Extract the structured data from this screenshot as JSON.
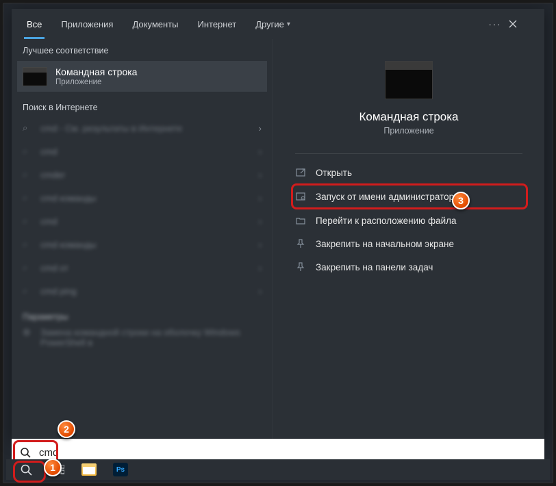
{
  "tabs": {
    "all": "Все",
    "apps": "Приложения",
    "docs": "Документы",
    "web": "Интернет",
    "other": "Другие"
  },
  "sections": {
    "best": "Лучшее соответствие",
    "web": "Поиск в Интернете",
    "params": "Параметры"
  },
  "best_match": {
    "title": "Командная строка",
    "subtitle": "Приложение"
  },
  "web_results": [
    "cmd - См. результаты в Интернете",
    "cmd",
    "cmder",
    "cmd команды",
    "cmd",
    "cmd команды",
    "cmd от",
    "cmd ping"
  ],
  "param_result": "Замена командной строки на оболочку Windows PowerShell в",
  "preview": {
    "title": "Командная строка",
    "subtitle": "Приложение"
  },
  "actions": {
    "open": "Открыть",
    "run_admin": "Запуск от имени администратора",
    "open_location": "Перейти к расположению файла",
    "pin_start": "Закрепить на начальном экране",
    "pin_taskbar": "Закрепить на панели задач"
  },
  "search": {
    "value": "cmd"
  },
  "badges": {
    "b1": "1",
    "b2": "2",
    "b3": "3"
  }
}
